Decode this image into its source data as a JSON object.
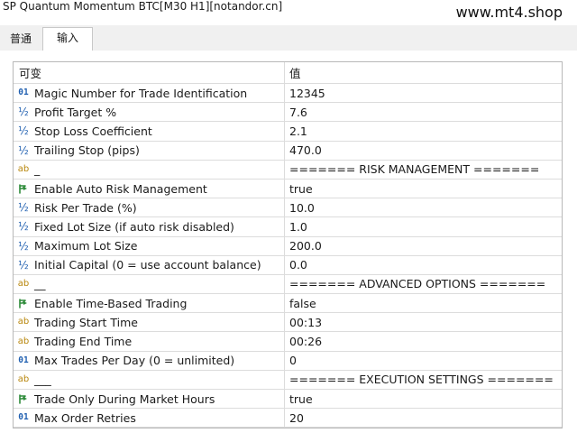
{
  "window": {
    "title": "SP Quantum Momentum BTC[M30 H1][notandor.cn]",
    "watermark": "www.mt4.shop"
  },
  "tabs": [
    {
      "label": "普通",
      "active": false
    },
    {
      "label": "输入",
      "active": true
    }
  ],
  "grid": {
    "columns": {
      "variable": "可变",
      "value": "值"
    },
    "rows": [
      {
        "type": "int",
        "icon_text": "01",
        "name": "Magic Number for Trade Identification",
        "value": "12345"
      },
      {
        "type": "double",
        "icon_text": "½",
        "name": "Profit Target %",
        "value": "7.6"
      },
      {
        "type": "double",
        "icon_text": "½",
        "name": "Stop Loss Coefficient",
        "value": "2.1"
      },
      {
        "type": "double",
        "icon_text": "½",
        "name": "Trailing Stop (pips)",
        "value": "470.0"
      },
      {
        "type": "string",
        "icon_text": "ab",
        "name": "_",
        "value": "======= RISK MANAGEMENT ======="
      },
      {
        "type": "bool",
        "icon_text": "",
        "name": "Enable Auto Risk Management",
        "value": "true"
      },
      {
        "type": "double",
        "icon_text": "½",
        "name": "Risk Per Trade (%)",
        "value": "10.0"
      },
      {
        "type": "double",
        "icon_text": "½",
        "name": "Fixed Lot Size (if auto risk disabled)",
        "value": "1.0"
      },
      {
        "type": "double",
        "icon_text": "½",
        "name": "Maximum Lot Size",
        "value": "200.0"
      },
      {
        "type": "double",
        "icon_text": "½",
        "name": "Initial Capital (0 = use account balance)",
        "value": "0.0"
      },
      {
        "type": "string",
        "icon_text": "ab",
        "name": "__",
        "value": "======= ADVANCED OPTIONS ======="
      },
      {
        "type": "bool",
        "icon_text": "",
        "name": "Enable Time-Based Trading",
        "value": "false"
      },
      {
        "type": "string",
        "icon_text": "ab",
        "name": "Trading Start Time",
        "value": "00:13"
      },
      {
        "type": "string",
        "icon_text": "ab",
        "name": "Trading End Time",
        "value": "00:26"
      },
      {
        "type": "int",
        "icon_text": "01",
        "name": "Max Trades Per Day (0 = unlimited)",
        "value": "0"
      },
      {
        "type": "string",
        "icon_text": "ab",
        "name": "___",
        "value": "======= EXECUTION SETTINGS ======="
      },
      {
        "type": "bool",
        "icon_text": "",
        "name": "Trade Only During Market Hours",
        "value": "true"
      },
      {
        "type": "int",
        "icon_text": "01",
        "name": "Max Order Retries",
        "value": "20"
      }
    ]
  },
  "colors": {
    "int_icon": "#1f5fb0",
    "double_icon": "#1f5fb0",
    "string_icon": "#b8860b",
    "bool_icon": "#2e8b3a"
  }
}
